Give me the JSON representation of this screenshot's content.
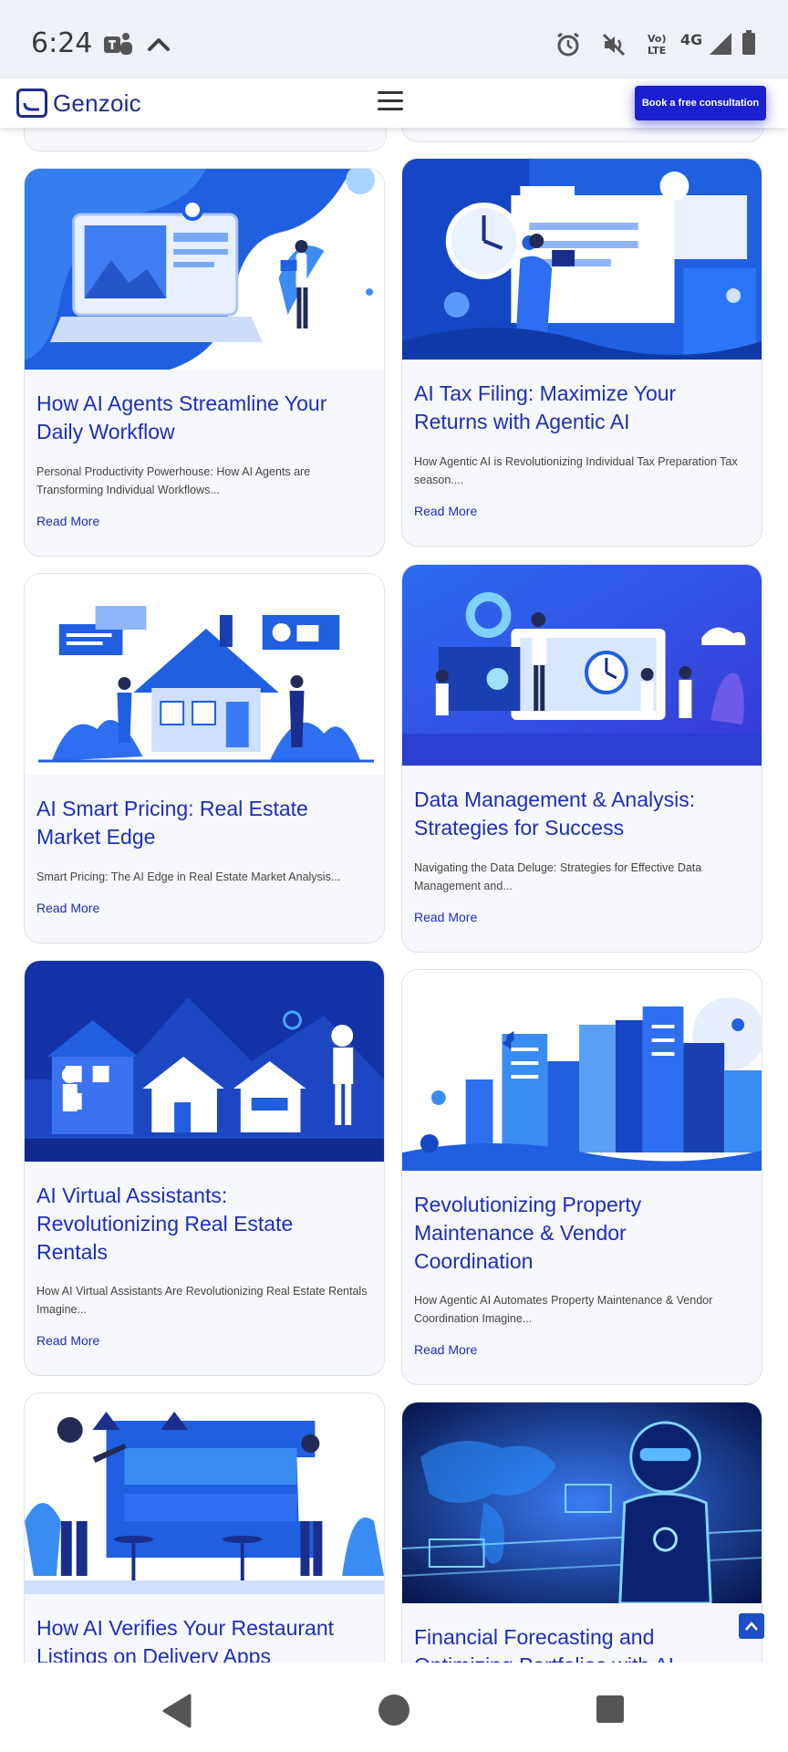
{
  "status_bar": {
    "time": "6:24",
    "volte_label_top": "Vo)",
    "volte_label_bottom": "LTE",
    "network": "4G",
    "icons": [
      "teams-icon",
      "chevron-up-icon",
      "alarm-icon",
      "mute-icon",
      "volte-icon",
      "signal-icon",
      "battery-icon"
    ]
  },
  "header": {
    "brand": "Genzoic",
    "menu_icon": "hamburger-icon",
    "cta_label": "Book a free consultation",
    "accent": "#1a1fd0"
  },
  "cards": [
    {
      "title": "How AI Agents Streamline Your Daily Workflow",
      "excerpt": "Personal Productivity Powerhouse: How AI Agents are Transforming Individual Workflows...",
      "link": "Read More"
    },
    {
      "title": "AI Tax Filing: Maximize Your Returns with Agentic AI",
      "excerpt": "How Agentic AI is Revolutionizing Individual Tax Preparation Tax season....",
      "link": "Read More"
    },
    {
      "title": "AI Smart Pricing: Real Estate Market Edge",
      "excerpt": "Smart Pricing: The AI Edge in Real Estate Market Analysis...",
      "link": "Read More"
    },
    {
      "title": "Data Management & Analysis: Strategies for Success",
      "excerpt": "Navigating the Data Deluge: Strategies for Effective Data Management and...",
      "link": "Read More"
    },
    {
      "title": "AI Virtual Assistants: Revolutionizing Real Estate Rentals",
      "excerpt": "How AI Virtual Assistants Are Revolutionizing Real Estate Rentals Imagine...",
      "link": "Read More"
    },
    {
      "title": "Revolutionizing Property Maintenance & Vendor Coordination",
      "excerpt": "How Agentic AI Automates Property Maintenance & Vendor Coordination Imagine...",
      "link": "Read More"
    },
    {
      "title": "How AI Verifies Your Restaurant Listings on Delivery Apps",
      "excerpt": "",
      "link": ""
    },
    {
      "title": "Financial Forecasting and Optimizing Portfolios with AI",
      "excerpt": "",
      "link": ""
    }
  ],
  "scroll_top_icon": "arrow-up-icon",
  "nav_bar": {
    "icons": [
      "back-icon",
      "home-icon",
      "recents-icon"
    ]
  },
  "colors": {
    "title_blue": "#1b2fb8",
    "card_bg": "#f7f8fb",
    "status_bg": "#eef1f8"
  }
}
